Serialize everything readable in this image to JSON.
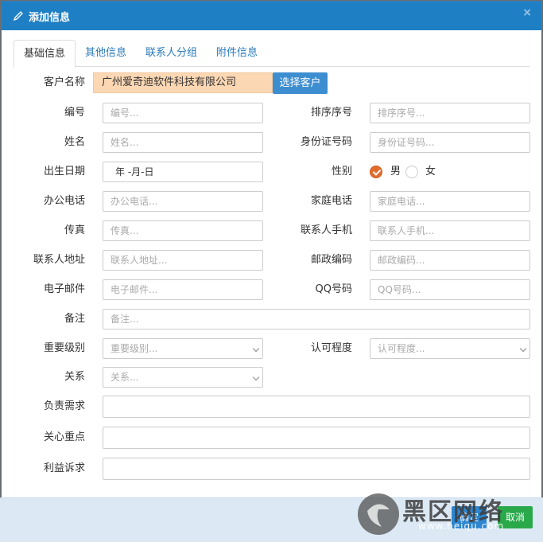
{
  "dialog": {
    "title": "添加信息",
    "close": "×"
  },
  "tabs": [
    {
      "label": "基础信息"
    },
    {
      "label": "其他信息"
    },
    {
      "label": "联系人分组"
    },
    {
      "label": "附件信息"
    }
  ],
  "form": {
    "customer_label": "客户名称",
    "customer_value": "广州爱奇迪软件科技有限公司",
    "choose_customer": "选择客户",
    "code_label": "编号",
    "code_ph": "编号...",
    "sort_label": "排序序号",
    "sort_ph": "排序序号...",
    "name_label": "姓名",
    "name_ph": "姓名...",
    "idcard_label": "身份证号码",
    "idcard_ph": "身份证号码...",
    "birth_label": "出生日期",
    "birth_value": "年 -月-日",
    "gender_label": "性别",
    "gender_male": "男",
    "gender_female": "女",
    "office_phone_label": "办公电话",
    "office_phone_ph": "办公电话...",
    "home_phone_label": "家庭电话",
    "home_phone_ph": "家庭电话...",
    "fax_label": "传真",
    "fax_ph": "传真...",
    "mobile_label": "联系人手机",
    "mobile_ph": "联系人手机...",
    "address_label": "联系人地址",
    "address_ph": "联系人地址...",
    "zip_label": "邮政编码",
    "zip_ph": "邮政编码...",
    "email_label": "电子邮件",
    "email_ph": "电子邮件...",
    "qq_label": "QQ号码",
    "qq_ph": "QQ号码...",
    "remark_label": "备注",
    "remark_ph": "备注...",
    "level_label": "重要级别",
    "level_ph": "重要级别...",
    "recognition_label": "认可程度",
    "recognition_ph": "认可程度...",
    "relation_label": "关系",
    "relation_ph": "关系...",
    "demand_label": "负责需求",
    "focus_label": "关心重点",
    "interest_label": "利益诉求"
  },
  "footer": {
    "ok": "确定",
    "cancel": "取消"
  },
  "watermark": {
    "text": "黑区网络",
    "url": "www.heiqu.com"
  }
}
